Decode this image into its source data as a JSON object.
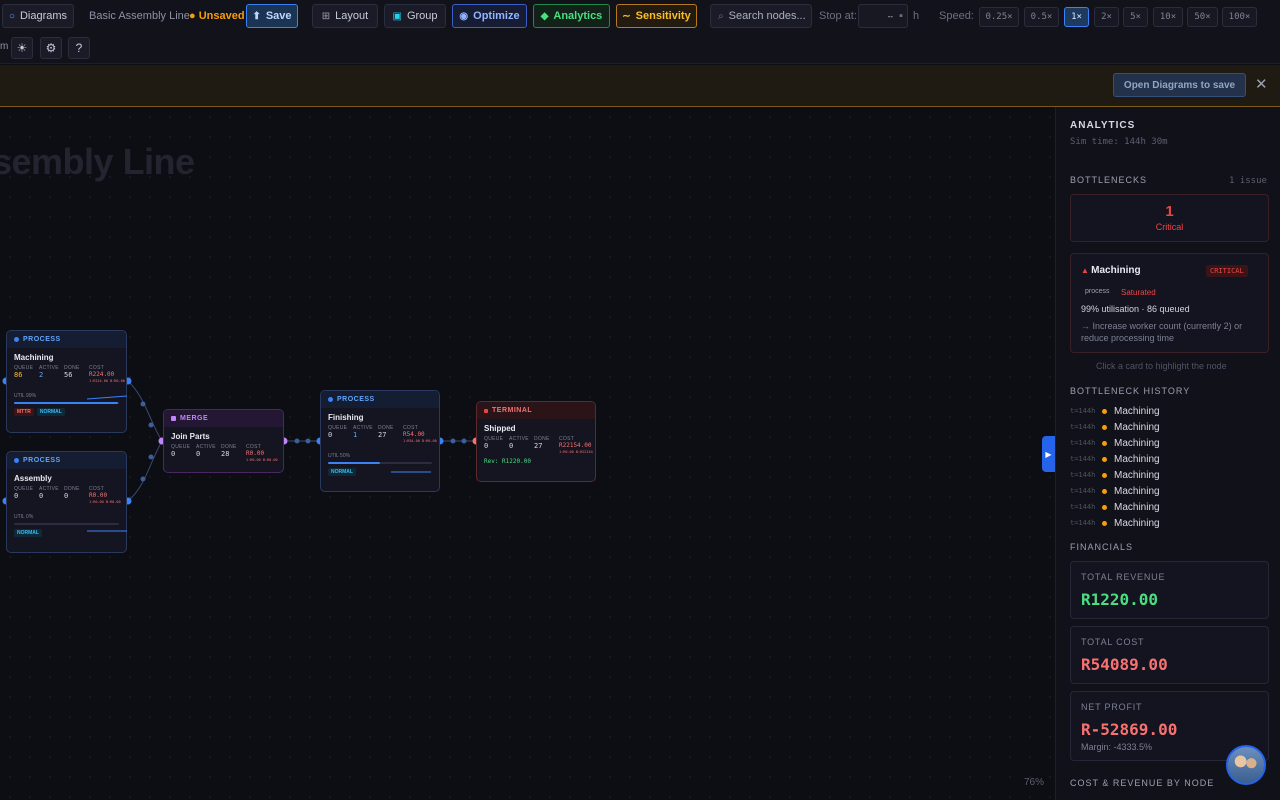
{
  "toolbar": {
    "diagrams_label": "Diagrams",
    "diagram_name": "Basic Assembly Line",
    "unsaved_label": "Unsaved",
    "save_label": "Save",
    "layout_label": "Layout",
    "group_label": "Group",
    "optimize_label": "Optimize",
    "analytics_label": "Analytics",
    "sensitivity_label": "Sensitivity",
    "search_placeholder": "Search nodes...",
    "stop_at_label": "Stop at:",
    "stop_at_value": "--",
    "stop_at_unit": "h",
    "speed_label": "Speed:",
    "speeds": [
      "0.25×",
      "0.5×",
      "1×",
      "2×",
      "5×",
      "10×",
      "50×",
      "100×"
    ],
    "active_speed": "1×",
    "row2_prefix": "m"
  },
  "banner": {
    "open_button": "Open Diagrams to save",
    "close": "✕"
  },
  "canvas": {
    "ghost_title": "sembly Line",
    "zoom": "76%",
    "nodes": {
      "machining": {
        "type": "PROCESS",
        "name": "Machining",
        "queue": "86",
        "active": "2",
        "done": "56",
        "cost": "R224.00",
        "cost_sub": "1:R224.00 B:R0.00",
        "util": "UTIL 99%",
        "util_fraction": 0.99,
        "tags": [
          "MTTR",
          "NORMAL"
        ]
      },
      "assembly": {
        "type": "PROCESS",
        "name": "Assembly",
        "queue": "0",
        "active": "0",
        "done": "0",
        "cost": "R0.00",
        "cost_sub": "1:R0.00 B:R0.00",
        "util": "UTIL 0%",
        "util_fraction": 0.0,
        "tags": [
          "NORMAL"
        ]
      },
      "join": {
        "type": "MERGE",
        "name": "Join Parts",
        "queue": "0",
        "active": "0",
        "done": "28",
        "cost": "R0.00",
        "cost_sub": "1:R0.00 B:R0.00"
      },
      "finishing": {
        "type": "PROCESS",
        "name": "Finishing",
        "queue": "0",
        "active": "1",
        "done": "27",
        "cost": "R54.00",
        "cost_sub": "1:R54.00 B:R0.00",
        "util": "UTIL 50%",
        "util_fraction": 0.5,
        "tags": [
          "NORMAL"
        ]
      },
      "shipped": {
        "type": "TERMINAL",
        "name": "Shipped",
        "queue": "0",
        "active": "0",
        "done": "27",
        "cost": "R22154.00",
        "cost_sub": "1:R0.00 B:R22154",
        "rev": "Rev: R1220.00"
      }
    },
    "col_labels": {
      "queue": "QUEUE",
      "active": "ACTIVE",
      "done": "DONE",
      "cost": "COST"
    }
  },
  "panel": {
    "title": "ANALYTICS",
    "sim_time": "Sim time: 144h 30m",
    "bottlenecks_title": "BOTTLENECKS",
    "bottlenecks_count": "1 issue",
    "critical_count": "1",
    "critical_label": "Critical",
    "bottleneck": {
      "name": "Machining",
      "severity": "CRITICAL",
      "kind": "process",
      "state": "Saturated",
      "summary": "99% utilisation · 86 queued",
      "advice": "Increase worker count (currently 2) or reduce processing time"
    },
    "hint": "Click a card to highlight the node",
    "history_title": "BOTTLENECK HISTORY",
    "history": [
      {
        "t": "t=144h",
        "name": "Machining"
      },
      {
        "t": "t=144h",
        "name": "Machining"
      },
      {
        "t": "t=144h",
        "name": "Machining"
      },
      {
        "t": "t=144h",
        "name": "Machining"
      },
      {
        "t": "t=144h",
        "name": "Machining"
      },
      {
        "t": "t=144h",
        "name": "Machining"
      },
      {
        "t": "t=144h",
        "name": "Machining"
      },
      {
        "t": "t=144h",
        "name": "Machining"
      }
    ],
    "financials_title": "FINANCIALS",
    "total_revenue_label": "TOTAL REVENUE",
    "total_revenue": "R1220.00",
    "total_cost_label": "TOTAL COST",
    "total_cost": "R54089.00",
    "net_profit_label": "NET PROFIT",
    "net_profit": "R-52869.00",
    "margin": "Margin: -4333.5%",
    "cost_rev_title": "COST & REVENUE BY NODE"
  },
  "colors": {
    "accent": "#3b82f6",
    "critical": "#ef4444",
    "revenue": "#4ade80",
    "warning": "#f59e0b",
    "merge": "#c084fc"
  }
}
